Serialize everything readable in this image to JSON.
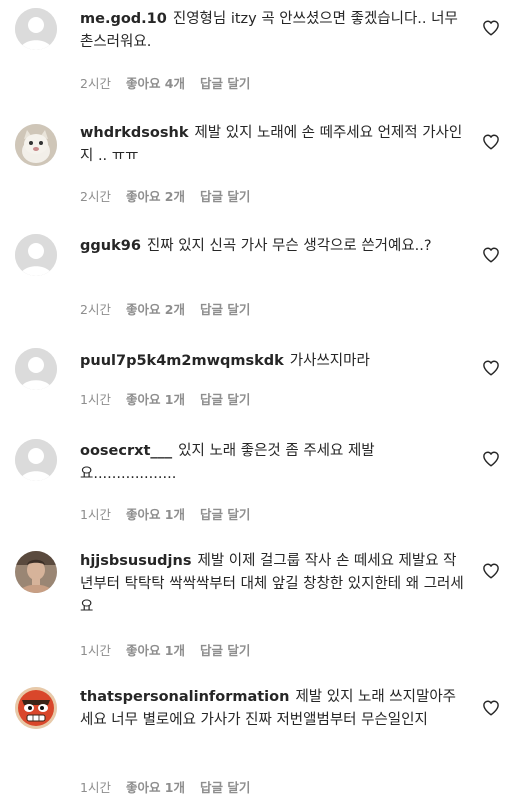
{
  "comments": [
    {
      "username": "me.god.10",
      "text": "진영형님 itzy 곡 안쓰셨으면 좋겠습니다.. 너무 촌스러워요.",
      "time": "2시간",
      "likes": "좋아요 4개",
      "reply": "답글 달기",
      "avatar": "default-avatar-icon"
    },
    {
      "username": "whdrkdsoshk",
      "text": "제발 있지 노래에 손 떼주세요 언제적 가사인지 .. ㅠㅠ",
      "time": "2시간",
      "likes": "좋아요 2개",
      "reply": "답글 달기",
      "avatar": "cat-avatar-icon"
    },
    {
      "username": "gguk96",
      "text": "진짜 있지 신곡 가사 무슨 생각으로 쓴거예요..?",
      "time": "2시간",
      "likes": "좋아요 2개",
      "reply": "답글 달기",
      "avatar": "default-avatar-icon"
    },
    {
      "username": "puul7p5k4m2mwqmskdk",
      "text": "가사쓰지마라",
      "time": "1시간",
      "likes": "좋아요 1개",
      "reply": "답글 달기",
      "avatar": "default-avatar-icon"
    },
    {
      "username": "oosecrxt___",
      "text": "있지 노래 좋은것 좀 주세요 제발요..................",
      "time": "1시간",
      "likes": "좋아요 1개",
      "reply": "답글 달기",
      "avatar": "default-avatar-icon"
    },
    {
      "username": "hjjsbsusudjns",
      "text": "제발 이제 걸그룹 작사 손 떼세요 제발요 작년부터 탁탁탁 싹싹싹부터 대체 앞길 창창한 있지한테 왜 그러세요",
      "time": "1시간",
      "likes": "좋아요 1개",
      "reply": "답글 달기",
      "avatar": "person-photo-avatar-icon"
    },
    {
      "username": "thatspersonalinformation",
      "text": "제발 있지 노래 쓰지말아주세요 너무 별로에요 가사가 진짜 저번앨범부터 무슨일인지",
      "time": "1시간",
      "likes": "좋아요 1개",
      "reply": "답글 달기",
      "avatar": "cartoon-face-avatar-icon"
    }
  ]
}
